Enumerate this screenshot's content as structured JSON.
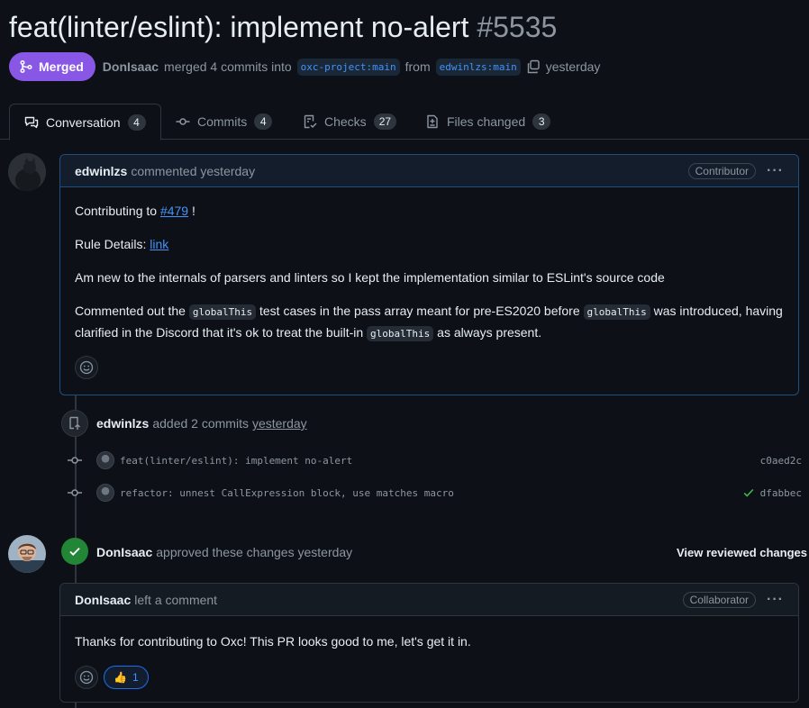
{
  "pr": {
    "title": "feat(linter/eslint): implement no-alert",
    "number": "#5535",
    "status": "Merged",
    "merger": "DonIsaac",
    "merge_text": "merged 4 commits into",
    "base_branch": "oxc-project:main",
    "from_text": "from",
    "head_branch": "edwinlzs:main",
    "time": "yesterday"
  },
  "tabs": [
    {
      "label": "Conversation",
      "count": "4"
    },
    {
      "label": "Commits",
      "count": "4"
    },
    {
      "label": "Checks",
      "count": "27"
    },
    {
      "label": "Files changed",
      "count": "3"
    }
  ],
  "comment1": {
    "author": "edwinlzs",
    "action": "commented yesterday",
    "role": "Contributor",
    "line1_pre": "Contributing to",
    "line1_link": "#479",
    "line1_post": "!",
    "line2_pre": "Rule Details:",
    "line2_link": "link",
    "line3": "Am new to the internals of parsers and linters so I kept the implementation similar to ESLint's source code",
    "line4_a": "Commented out the",
    "code": "globalThis",
    "line4_b": "test cases in the pass array meant for pre-ES2020 before",
    "line4_c": "was introduced, having clarified in the Discord that it's ok to treat the built-in",
    "line4_d": "as always present."
  },
  "commits_event": {
    "author": "edwinlzs",
    "action": "added 2 commits",
    "time": "yesterday"
  },
  "commits": [
    {
      "message": "feat(linter/eslint): implement no-alert",
      "sha": "c0aed2c",
      "check": false
    },
    {
      "message": "refactor: unnest CallExpression block, use matches macro",
      "sha": "dfabbec",
      "check": true
    }
  ],
  "review_event": {
    "author": "DonIsaac",
    "action": "approved these changes yesterday",
    "button": "View reviewed changes"
  },
  "comment2": {
    "author": "DonIsaac",
    "action": "left a comment",
    "role": "Collaborator",
    "body": "Thanks for contributing to Oxc! This PR looks good to me, let's get it in.",
    "reaction_emoji": "👍",
    "reaction_count": "1"
  },
  "colors": {
    "merged": "#8957e5",
    "approved": "#238636",
    "link": "#4493f8"
  }
}
